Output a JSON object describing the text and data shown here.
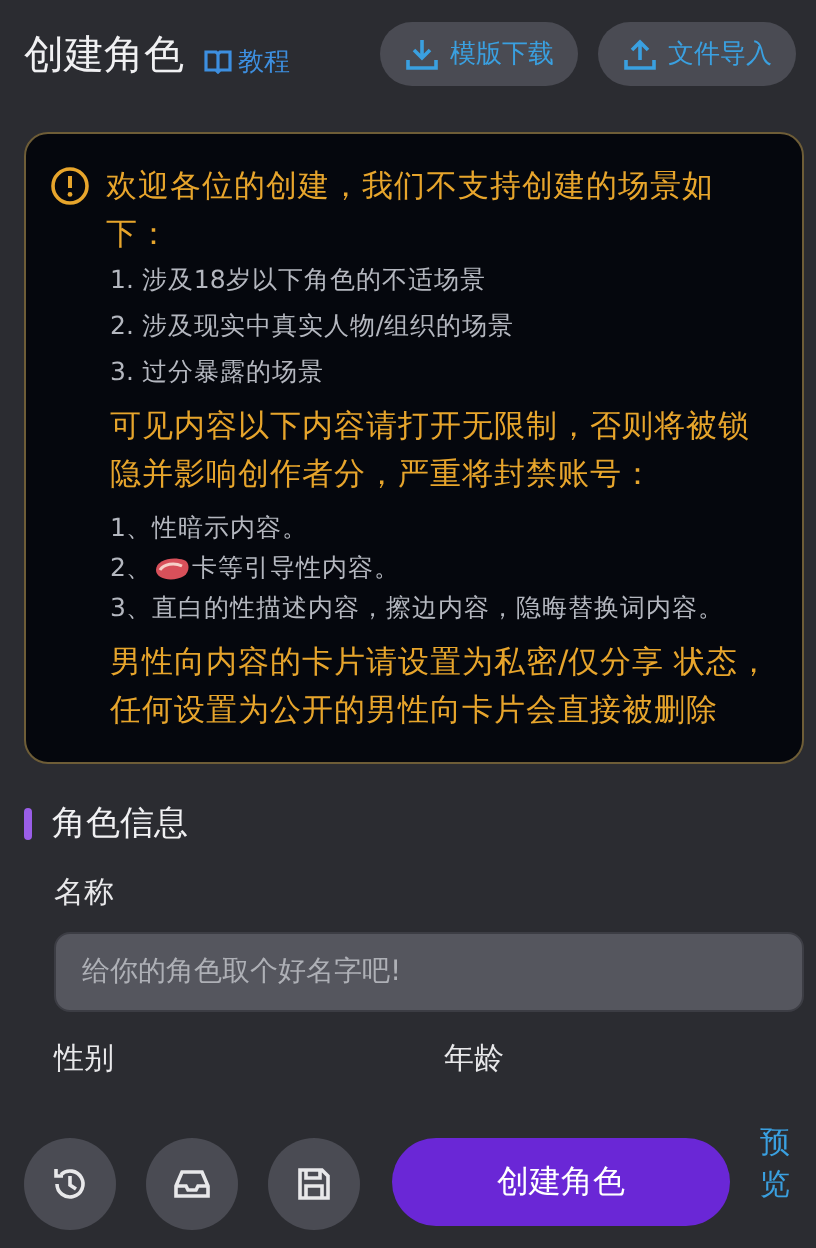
{
  "header": {
    "title": "创建角色",
    "tutorial_link": "教程",
    "buttons": [
      {
        "kind": "download",
        "label": "模版下载"
      },
      {
        "kind": "upload",
        "label": "文件导入"
      }
    ]
  },
  "notice": {
    "heading": "欢迎各位的创建，我们不支持创建的场景如下：",
    "scenes": [
      "1. 涉及18岁以下角色的不适场景",
      "2. 涉及现实中真实人物/组织的场景",
      "3. 过分暴露的场景"
    ],
    "warning": "可见内容以下内容请打开无限制，否则将被锁隐并影响创作者分，严重将封禁账号：",
    "content_rules": [
      {
        "kind": "text",
        "text": "1、性暗示内容。"
      },
      {
        "kind": "meat",
        "prefix": "2、",
        "text": "卡等引导性内容。"
      },
      {
        "kind": "text",
        "text": "3、直白的性描述内容，擦边内容，隐晦替换词内容。"
      }
    ],
    "footer": "男性向内容的卡片请设置为私密/仅分享 状态，任何设置为公开的男性向卡片会直接被删除"
  },
  "section": {
    "title": "角色信息",
    "name_label": "名称",
    "name_field": {
      "placeholder": "给你的角色取个好名字吧!"
    },
    "gender_label": "性别",
    "age_label": "年龄"
  },
  "toolbar": {
    "icons": [
      {
        "kind": "history"
      },
      {
        "kind": "inbox"
      },
      {
        "kind": "save"
      }
    ],
    "create_button": "创建角色",
    "preview": "预览"
  }
}
